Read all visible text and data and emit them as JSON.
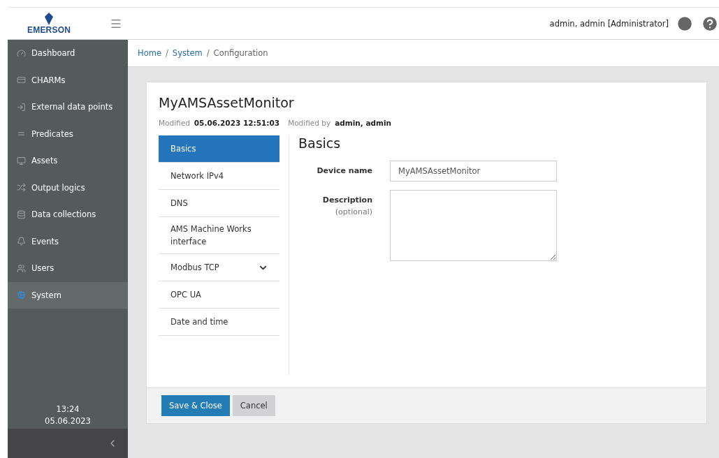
{
  "header": {
    "brand": "EMERSON",
    "user": "admin, admin [Administrator]"
  },
  "sidebar": {
    "items": [
      {
        "label": "Dashboard",
        "selected": false
      },
      {
        "label": "CHARMs",
        "selected": false
      },
      {
        "label": "External data points",
        "selected": false
      },
      {
        "label": "Predicates",
        "selected": false
      },
      {
        "label": "Assets",
        "selected": false
      },
      {
        "label": "Output logics",
        "selected": false
      },
      {
        "label": "Data collections",
        "selected": false
      },
      {
        "label": "Events",
        "selected": false
      },
      {
        "label": "Users",
        "selected": false
      },
      {
        "label": "System",
        "selected": true
      }
    ],
    "time": "13:24",
    "date": "05.06.2023"
  },
  "breadcrumb": [
    {
      "label": "Home",
      "kind": "link"
    },
    {
      "label": "/",
      "kind": "separator"
    },
    {
      "label": "System",
      "kind": "link"
    },
    {
      "label": "/",
      "kind": "separator"
    },
    {
      "label": "Configuration",
      "kind": "current"
    }
  ],
  "card": {
    "title": "MyAMSAssetMonitor",
    "modified_label": "Modified",
    "modified_value": "05.06.2023 12:51:03",
    "modified_by_label": "Modified by",
    "modified_by_value": "admin, admin",
    "nav": [
      {
        "label": "Basics",
        "kind": "plain",
        "selected": true
      },
      {
        "label": "Network IPv4",
        "kind": "plain",
        "selected": false
      },
      {
        "label": "DNS",
        "kind": "plain",
        "selected": false
      },
      {
        "label": "AMS Machine Works interface",
        "kind": "plain",
        "selected": false
      },
      {
        "label": "Modbus TCP",
        "kind": "group",
        "selected": false
      },
      {
        "label": "OPC UA",
        "kind": "plain",
        "selected": false
      },
      {
        "label": "Date and time",
        "kind": "plain",
        "selected": false
      }
    ],
    "section_title": "Basics",
    "fields": [
      {
        "label": "Device name",
        "kind": "input",
        "value": "MyAMSAssetMonitor"
      },
      {
        "label": "Description",
        "hint": "(optional)",
        "kind": "textarea"
      }
    ],
    "buttons": [
      {
        "label": "Save & Close",
        "kind": "primary"
      },
      {
        "label": "Cancel",
        "kind": "secondary"
      }
    ]
  }
}
